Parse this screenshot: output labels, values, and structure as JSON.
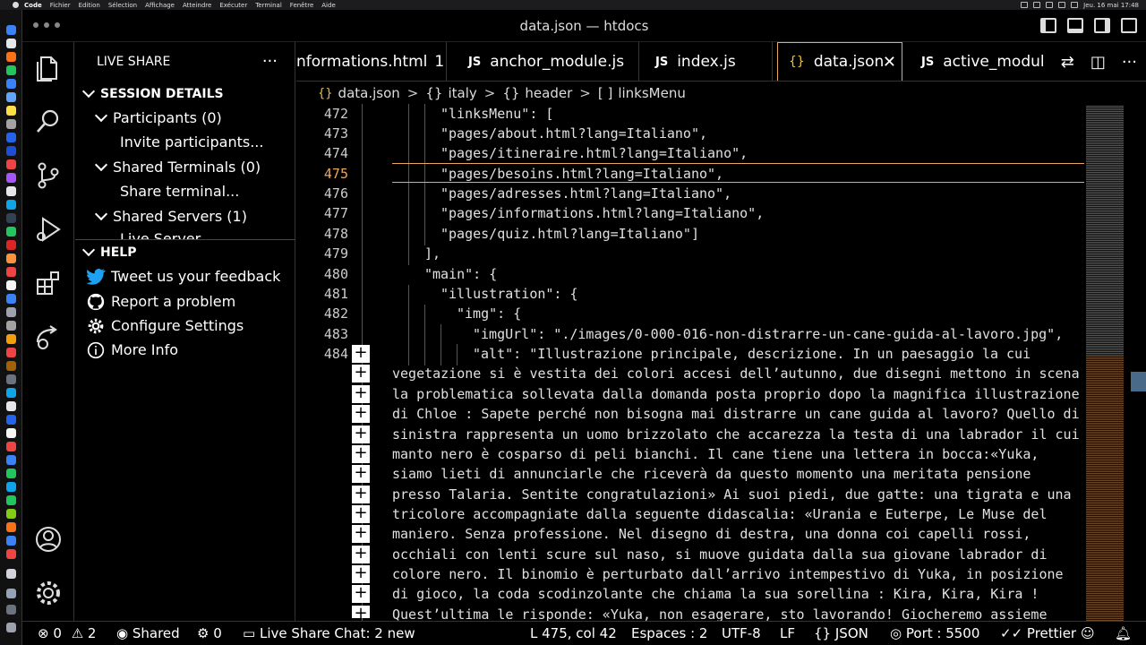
{
  "menubar": {
    "items": [
      "Code",
      "Fichier",
      "Edition",
      "Sélection",
      "Affichage",
      "Atteindre",
      "Exécuter",
      "Terminal",
      "Fenêtre",
      "Aide"
    ],
    "clock": "Jeu. 16 mai  17:48"
  },
  "window": {
    "title": "data.json — htdocs"
  },
  "live_share": {
    "header": "LIVE SHARE",
    "more": "···",
    "session_details": "SESSION DETAILS",
    "participants": "Participants (0)",
    "invite": "Invite participants...",
    "shared_terminals": "Shared Terminals (0)",
    "share_terminal": "Share terminal...",
    "shared_servers": "Shared Servers (1)",
    "live_server": "Live Server",
    "help": "HELP",
    "tweet": "Tweet us your feedback",
    "report": "Report a problem",
    "configure": "Configure Settings",
    "more_info": "More Info"
  },
  "tabs": [
    {
      "label": "nformations.html",
      "badge": "1",
      "icon": ""
    },
    {
      "label": "anchor_module.js",
      "icon": "JS"
    },
    {
      "label": "index.js",
      "icon": "JS"
    },
    {
      "label": "data.json",
      "icon": "{}"
    },
    {
      "label": "active_module.",
      "icon": "JS"
    }
  ],
  "breadcrumb": {
    "b1": "data.json",
    "b2": "italy",
    "b3": "header",
    "b4": "linksMenu",
    "i1": "{}",
    "i2": "{}",
    "i3": "{}",
    "i4": "[ ]",
    "sep": ">"
  },
  "editor": {
    "lines": [
      {
        "n": "472",
        "text": "\"linksMenu\": [",
        "indent": 3
      },
      {
        "n": "473",
        "text": "\"pages/about.html?lang=Italiano\",",
        "indent": 3
      },
      {
        "n": "474",
        "text": "\"pages/itineraire.html?lang=Italiano\",",
        "indent": 3
      },
      {
        "n": "475",
        "text": "\"pages/besoins.html?lang=Italiano\",",
        "indent": 3
      },
      {
        "n": "476",
        "text": "\"pages/adresses.html?lang=Italiano\",",
        "indent": 3
      },
      {
        "n": "477",
        "text": "\"pages/informations.html?lang=Italiano\",",
        "indent": 3
      },
      {
        "n": "478",
        "text": "\"pages/quiz.html?lang=Italiano\"]",
        "indent": 3
      },
      {
        "n": "479",
        "text": "],",
        "indent": 2
      },
      {
        "n": "480",
        "text": "\"main\": {",
        "indent": 2
      },
      {
        "n": "481",
        "text": "\"illustration\": {",
        "indent": 3
      },
      {
        "n": "482",
        "text": "\"img\": {",
        "indent": 4
      },
      {
        "n": "483",
        "text": "\"imgUrl\": \"./images/0-000-016-non-distrarre-un-cane-guida-al-lavoro.jpg\",",
        "indent": 5
      },
      {
        "n": "484",
        "text": "\"alt\": \"Illustrazione principale, descrizione. In un paesaggio la cui",
        "indent": 5
      }
    ],
    "wrapped": [
      "vegetazione si è vestita dei colori accesi dell’autunno, due disegni mettono in scena",
      "la problematica sollevata dalla domanda posta proprio dopo la magnifica illustrazione",
      "di Chloe : Sapete perché non bisogna mai distrarre un cane guida al lavoro? Quello di",
      "sinistra rappresenta un uomo brizzolato che accarezza la testa di una labrador il cui",
      "manto nero è cosparso di peli bianchi. Il cane tiene una lettera in bocca:«Yuka,",
      "siamo lieti di annunciarle che riceverà da questo momento una meritata pensione",
      "presso Talaria. Sentite congratulazioni» Ai suoi piedi, due gatte: una tigrata e una",
      "tricolore accompagniate dalla seguente didascalia: «Urania e Euterpe, Le Muse del",
      "maniero. Senza professione. Nel disegno di destra, una donna coi capelli rossi,",
      "occhiali con lenti scure sul naso, si muove guidata dalla sua giovane labrador di",
      "colore nero. Il binomio è perturbato dall’arrivo intempestivo di Yuka, in posizione",
      "di gioco, la coda scodinzolante che chiama la sua sorellina : Kira, Kira, Kira !",
      "Quest’ultima le risponde: «Yuka, non esagerare, sto lavorando! Giocheremo assieme"
    ],
    "current_line": "475"
  },
  "status": {
    "errors": "0",
    "warnings": "2",
    "shared": "Shared",
    "ports_count": "0",
    "chat": "Live Share Chat: 2 new",
    "position": "L 475, col 42",
    "spaces": "Espaces : 2",
    "encoding": "UTF-8",
    "eol": "LF",
    "language": "JSON",
    "port": "Port : 5500",
    "prettier": "Prettier"
  },
  "colors": {
    "accent_orange": "#e8a860",
    "json_brace_yellow": "#e8c34a",
    "twitter_blue": "#1da1f2"
  }
}
